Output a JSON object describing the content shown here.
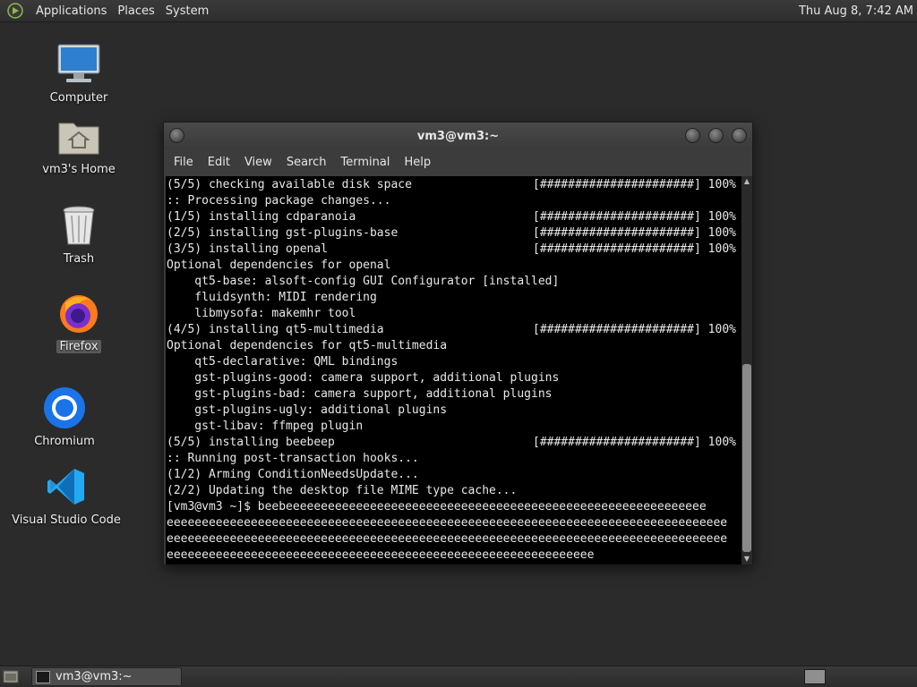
{
  "top_panel": {
    "menus": [
      "Applications",
      "Places",
      "System"
    ],
    "clock": "Thu Aug  8,  7:42 AM"
  },
  "desktop_icons": {
    "computer": "Computer",
    "home": "vm3's Home",
    "trash": "Trash",
    "firefox": "Firefox",
    "chromium": "Chromium",
    "vscode": "Visual Studio Code"
  },
  "terminal": {
    "title": "vm3@vm3:~",
    "menus": [
      "File",
      "Edit",
      "View",
      "Search",
      "Terminal",
      "Help"
    ],
    "lines": [
      {
        "text": "(5/5) checking available disk space",
        "progress": "[######################] 100%"
      },
      {
        "text": ":: Processing package changes...",
        "progress": ""
      },
      {
        "text": "(1/5) installing cdparanoia",
        "progress": "[######################] 100%"
      },
      {
        "text": "(2/5) installing gst-plugins-base",
        "progress": "[######################] 100%"
      },
      {
        "text": "(3/5) installing openal",
        "progress": "[######################] 100%"
      },
      {
        "text": "Optional dependencies for openal",
        "progress": ""
      },
      {
        "text": "    qt5-base: alsoft-config GUI Configurator [installed]",
        "progress": ""
      },
      {
        "text": "    fluidsynth: MIDI rendering",
        "progress": ""
      },
      {
        "text": "    libmysofa: makemhr tool",
        "progress": ""
      },
      {
        "text": "(4/5) installing qt5-multimedia",
        "progress": "[######################] 100%"
      },
      {
        "text": "Optional dependencies for qt5-multimedia",
        "progress": ""
      },
      {
        "text": "    qt5-declarative: QML bindings",
        "progress": ""
      },
      {
        "text": "    gst-plugins-good: camera support, additional plugins",
        "progress": ""
      },
      {
        "text": "    gst-plugins-bad: camera support, additional plugins",
        "progress": ""
      },
      {
        "text": "    gst-plugins-ugly: additional plugins",
        "progress": ""
      },
      {
        "text": "    gst-libav: ffmpeg plugin",
        "progress": ""
      },
      {
        "text": "(5/5) installing beebeep",
        "progress": "[######################] 100%"
      },
      {
        "text": ":: Running post-transaction hooks...",
        "progress": ""
      },
      {
        "text": "(1/2) Arming ConditionNeedsUpdate...",
        "progress": ""
      },
      {
        "text": "(2/2) Updating the desktop file MIME type cache...",
        "progress": ""
      },
      {
        "text": "[vm3@vm3 ~]$ beebeeeeeeeeeeeeeeeeeeeeeeeeeeeeeeeeeeeeeeeeeeeeeeeeeeeeeeeeeeee",
        "progress": ""
      },
      {
        "text": "eeeeeeeeeeeeeeeeeeeeeeeeeeeeeeeeeeeeeeeeeeeeeeeeeeeeeeeeeeeeeeeeeeeeeeeeeeeeeeee",
        "progress": ""
      },
      {
        "text": "eeeeeeeeeeeeeeeeeeeeeeeeeeeeeeeeeeeeeeeeeeeeeeeeeeeeeeeeeeeeeeeeeeeeeeeeeeeeeeee",
        "progress": ""
      },
      {
        "text": "eeeeeeeeeeeeeeeeeeeeeeeeeeeeeeeeeeeeeeeeeeeeeeeeeeeeeeeeeeeee",
        "progress": ""
      }
    ]
  },
  "bottom_panel": {
    "task_label": "vm3@vm3:~"
  }
}
